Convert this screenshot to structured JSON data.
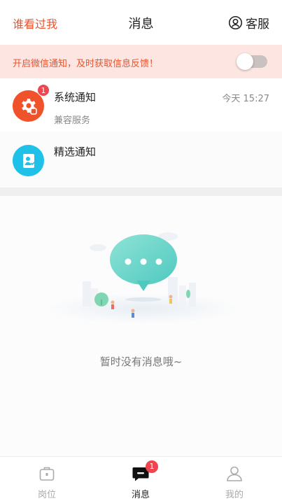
{
  "header": {
    "left_link": "谁看过我",
    "title": "消息",
    "service_label": "客服"
  },
  "banner": {
    "text": "开启微信通知，及时获取信息反馈！",
    "toggle_on": false
  },
  "messages": [
    {
      "title": "系统通知",
      "subtitle": "兼容服务",
      "time": "今天 15:27",
      "badge": "1",
      "icon": "gear-icon",
      "color": "#f0532b"
    },
    {
      "title": "精选通知",
      "icon": "document-icon",
      "color": "#1fc1e9"
    }
  ],
  "empty_state": {
    "text": "暂时没有消息哦~"
  },
  "tabs": [
    {
      "label": "岗位",
      "icon": "briefcase-icon",
      "active": false
    },
    {
      "label": "消息",
      "icon": "message-icon",
      "active": true,
      "badge": "1"
    },
    {
      "label": "我的",
      "icon": "user-icon",
      "active": false
    }
  ],
  "colors": {
    "accent": "#e8542f",
    "banner_bg": "#fde6e2",
    "badge": "#f0444e"
  }
}
